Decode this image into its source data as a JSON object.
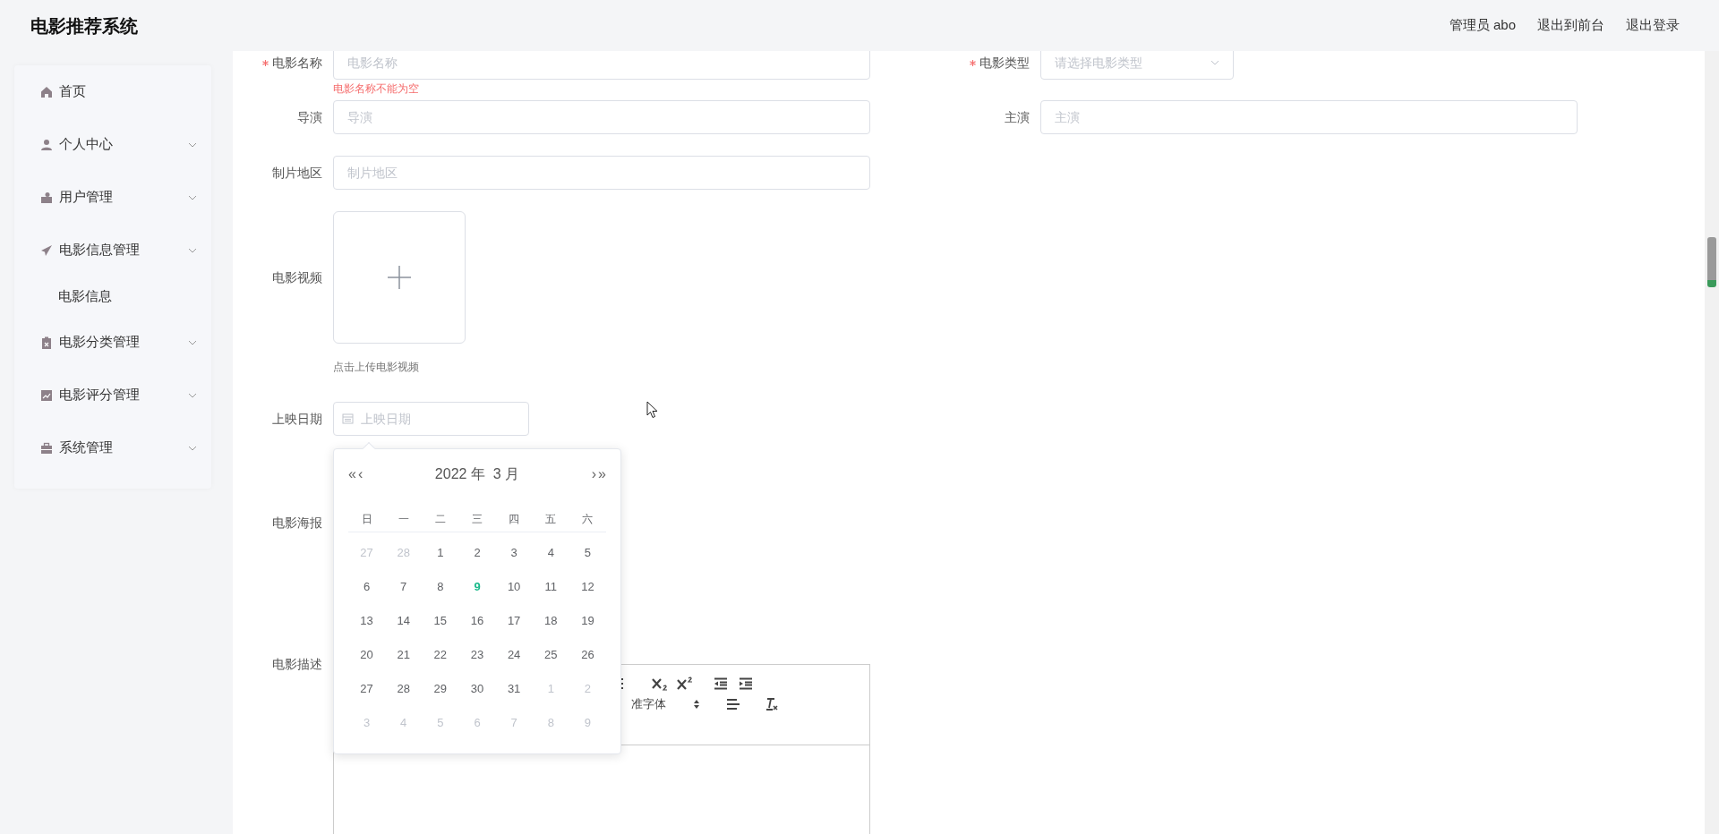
{
  "header": {
    "title": "电影推荐系统",
    "user": "管理员 abo",
    "links": [
      "退出到前台",
      "退出登录"
    ]
  },
  "sidebar": {
    "items": [
      {
        "label": "首页",
        "kind": "link"
      },
      {
        "label": "个人中心",
        "kind": "submenu"
      },
      {
        "label": "用户管理",
        "kind": "submenu"
      },
      {
        "label": "电影信息管理",
        "kind": "submenu",
        "children": [
          {
            "label": "电影信息"
          }
        ]
      },
      {
        "label": "电影分类管理",
        "kind": "submenu"
      },
      {
        "label": "电影评分管理",
        "kind": "submenu"
      },
      {
        "label": "系统管理",
        "kind": "submenu"
      }
    ]
  },
  "form": {
    "name": {
      "label": "电影名称",
      "required": true,
      "placeholder": "电影名称",
      "error": "电影名称不能为空"
    },
    "type": {
      "label": "电影类型",
      "required": true,
      "placeholder": "请选择电影类型"
    },
    "director": {
      "label": "导演",
      "required": false,
      "placeholder": "导演"
    },
    "cast": {
      "label": "主演",
      "required": false,
      "placeholder": "主演"
    },
    "region": {
      "label": "制片地区",
      "required": false,
      "placeholder": "制片地区"
    },
    "video": {
      "label": "电影视频",
      "hint": "点击上传电影视频"
    },
    "release_date": {
      "label": "上映日期",
      "placeholder": "上映日期"
    },
    "poster": {
      "label": "电影海报"
    },
    "description": {
      "label": "电影描述",
      "toolbar_font": "准字体"
    }
  },
  "date_picker": {
    "prev_year": "«",
    "prev_month": "‹",
    "title": "2022 年  3 月",
    "next_month": "›",
    "next_year": "»",
    "weekdays": [
      "日",
      "一",
      "二",
      "三",
      "四",
      "五",
      "六"
    ],
    "days": [
      {
        "day": "27",
        "in_month": false,
        "today": false
      },
      {
        "day": "28",
        "in_month": false,
        "today": false
      },
      {
        "day": "1",
        "in_month": true,
        "today": false
      },
      {
        "day": "2",
        "in_month": true,
        "today": false
      },
      {
        "day": "3",
        "in_month": true,
        "today": false
      },
      {
        "day": "4",
        "in_month": true,
        "today": false
      },
      {
        "day": "5",
        "in_month": true,
        "today": false
      },
      {
        "day": "6",
        "in_month": true,
        "today": false
      },
      {
        "day": "7",
        "in_month": true,
        "today": false
      },
      {
        "day": "8",
        "in_month": true,
        "today": false
      },
      {
        "day": "9",
        "in_month": true,
        "today": true
      },
      {
        "day": "10",
        "in_month": true,
        "today": false
      },
      {
        "day": "11",
        "in_month": true,
        "today": false
      },
      {
        "day": "12",
        "in_month": true,
        "today": false
      },
      {
        "day": "13",
        "in_month": true,
        "today": false
      },
      {
        "day": "14",
        "in_month": true,
        "today": false
      },
      {
        "day": "15",
        "in_month": true,
        "today": false
      },
      {
        "day": "16",
        "in_month": true,
        "today": false
      },
      {
        "day": "17",
        "in_month": true,
        "today": false
      },
      {
        "day": "18",
        "in_month": true,
        "today": false
      },
      {
        "day": "19",
        "in_month": true,
        "today": false
      },
      {
        "day": "20",
        "in_month": true,
        "today": false
      },
      {
        "day": "21",
        "in_month": true,
        "today": false
      },
      {
        "day": "22",
        "in_month": true,
        "today": false
      },
      {
        "day": "23",
        "in_month": true,
        "today": false
      },
      {
        "day": "24",
        "in_month": true,
        "today": false
      },
      {
        "day": "25",
        "in_month": true,
        "today": false
      },
      {
        "day": "26",
        "in_month": true,
        "today": false
      },
      {
        "day": "27",
        "in_month": true,
        "today": false
      },
      {
        "day": "28",
        "in_month": true,
        "today": false
      },
      {
        "day": "29",
        "in_month": true,
        "today": false
      },
      {
        "day": "30",
        "in_month": true,
        "today": false
      },
      {
        "day": "31",
        "in_month": true,
        "today": false
      },
      {
        "day": "1",
        "in_month": false,
        "today": false
      },
      {
        "day": "2",
        "in_month": false,
        "today": false
      },
      {
        "day": "3",
        "in_month": false,
        "today": false
      },
      {
        "day": "4",
        "in_month": false,
        "today": false
      },
      {
        "day": "5",
        "in_month": false,
        "today": false
      },
      {
        "day": "6",
        "in_month": false,
        "today": false
      },
      {
        "day": "7",
        "in_month": false,
        "today": false
      },
      {
        "day": "8",
        "in_month": false,
        "today": false
      },
      {
        "day": "9",
        "in_month": false,
        "today": false
      }
    ]
  }
}
